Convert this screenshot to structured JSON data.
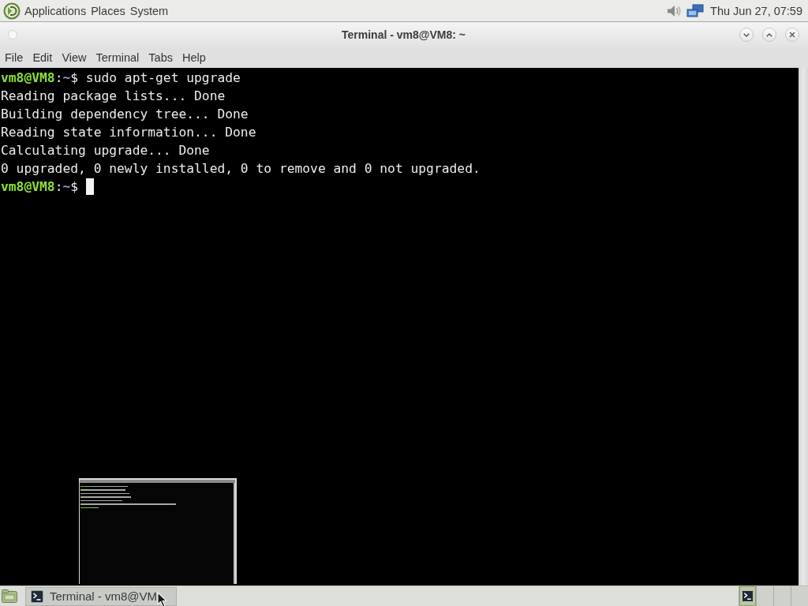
{
  "top_panel": {
    "menus": [
      "Applications",
      "Places",
      "System"
    ],
    "clock": "Thu Jun 27, 07:59"
  },
  "window": {
    "title": "Terminal - vm8@VM8: ~",
    "menu": [
      "File",
      "Edit",
      "View",
      "Terminal",
      "Tabs",
      "Help"
    ]
  },
  "terminal": {
    "lines": [
      {
        "kind": "prompt",
        "user": "vm8@VM8",
        "separator": ":",
        "path": "~",
        "sign": "$",
        "command": "sudo apt-get upgrade",
        "cursor": false
      },
      {
        "kind": "output",
        "text": "Reading package lists... Done"
      },
      {
        "kind": "output",
        "text": "Building dependency tree... Done"
      },
      {
        "kind": "output",
        "text": "Reading state information... Done"
      },
      {
        "kind": "output",
        "text": "Calculating upgrade... Done"
      },
      {
        "kind": "output",
        "text": "0 upgraded, 0 newly installed, 0 to remove and 0 not upgraded."
      },
      {
        "kind": "prompt",
        "user": "vm8@VM8",
        "separator": ":",
        "path": "~",
        "sign": "$",
        "cursor": true
      }
    ]
  },
  "taskbar": {
    "tasks": [
      {
        "label": "Terminal - vm8@VM",
        "selected": true
      }
    ],
    "workspaces": [
      {
        "selected": true,
        "occupied": true
      },
      {
        "selected": false,
        "occupied": false
      },
      {
        "selected": false,
        "occupied": false
      },
      {
        "selected": false,
        "occupied": false
      }
    ]
  }
}
